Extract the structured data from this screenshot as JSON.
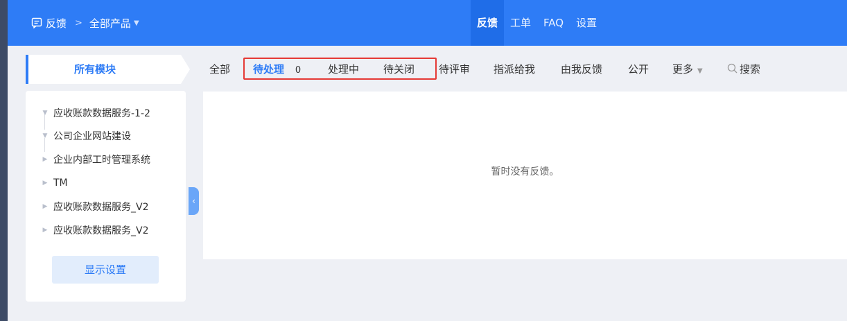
{
  "header": {
    "brand_label": "反馈",
    "separator": ">",
    "product_label": "全部产品",
    "nav": [
      {
        "label": "反馈",
        "active": true
      },
      {
        "label": "工单",
        "active": false
      },
      {
        "label": "FAQ",
        "active": false
      },
      {
        "label": "设置",
        "active": false
      }
    ]
  },
  "sidebar": {
    "module_tab_label": "所有模块",
    "tree_items": [
      {
        "label": "应收账款数据服务-1-2",
        "expanded": true
      },
      {
        "label": "公司企业网站建设",
        "expanded": true
      },
      {
        "label": "企业内部工时管理系统",
        "expanded": false
      },
      {
        "label": "TM",
        "expanded": false
      },
      {
        "label": "应收账款数据服务_V2",
        "expanded": false
      },
      {
        "label": "应收账款数据服务_V2",
        "expanded": false
      }
    ],
    "display_settings_label": "显示设置",
    "collapse_glyph": "‹"
  },
  "filter_tabs": {
    "all": "全部",
    "pending": "待处理",
    "pending_count": "0",
    "processing": "处理中",
    "to_close": "待关闭",
    "to_review": "待评审",
    "assigned_to_me": "指派给我",
    "reported_by_me": "由我反馈",
    "public": "公开",
    "more": "更多",
    "search": "搜索"
  },
  "content": {
    "empty_message": "暂时没有反馈。"
  },
  "colors": {
    "primary": "#2e7cf6",
    "highlight_border": "#e53935"
  }
}
